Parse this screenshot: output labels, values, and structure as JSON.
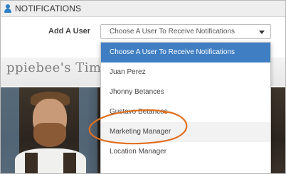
{
  "header": {
    "title": "NOTIFICATIONS",
    "icon": "user-icon"
  },
  "form": {
    "label": "Add A User",
    "select_value": "Choose A User To Receive Notifications"
  },
  "background": {
    "partial_text": "ppiebee's Times Sq"
  },
  "dropdown": {
    "options": [
      "Choose A User To Receive Notifications",
      "Juan Perez",
      "Jhonny Betances",
      "Gustavo Betances",
      "Marketing Manager",
      "Location Manager"
    ],
    "selected_index": 0,
    "highlighted_option": "Marketing Manager"
  },
  "colors": {
    "accent": "#3f7ec3",
    "annotation": "#e07020"
  }
}
